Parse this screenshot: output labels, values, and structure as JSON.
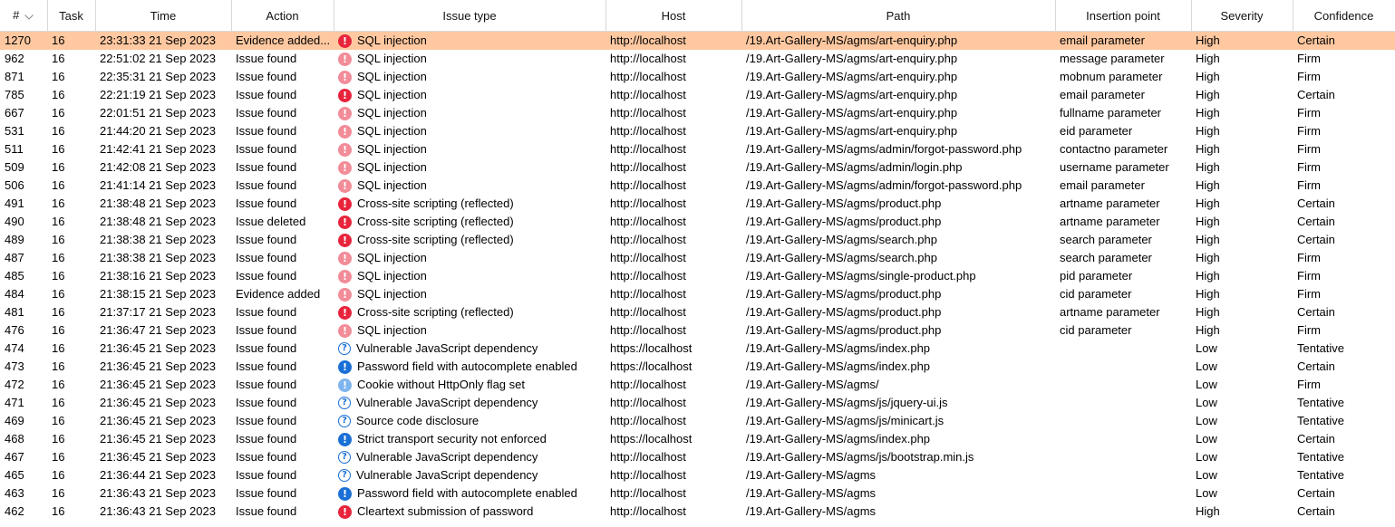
{
  "headers": {
    "num": "#",
    "task": "Task",
    "time": "Time",
    "action": "Action",
    "issue_type": "Issue type",
    "host": "Host",
    "path": "Path",
    "insertion_point": "Insertion point",
    "severity": "Severity",
    "confidence": "Confidence"
  },
  "colors": {
    "selected_row": "#ffc8a0",
    "high_certain": "#e8243c",
    "high_firm": "#f28c98",
    "info_certain": "#1a6fd6",
    "info_firm": "#7fb5ee"
  },
  "rows": [
    {
      "num": "1270",
      "task": "16",
      "time": "23:31:33 21 Sep 2023",
      "action": "Evidence added...",
      "icon": "high-certain",
      "issue": "SQL injection",
      "host": "http://localhost",
      "path": "/19.Art-Gallery-MS/agms/art-enquiry.php",
      "insertion": "email parameter",
      "severity": "High",
      "confidence": "Certain",
      "selected": true
    },
    {
      "num": "962",
      "task": "16",
      "time": "22:51:02 21 Sep 2023",
      "action": "Issue found",
      "icon": "high-firm",
      "issue": "SQL injection",
      "host": "http://localhost",
      "path": "/19.Art-Gallery-MS/agms/art-enquiry.php",
      "insertion": "message parameter",
      "severity": "High",
      "confidence": "Firm"
    },
    {
      "num": "871",
      "task": "16",
      "time": "22:35:31 21 Sep 2023",
      "action": "Issue found",
      "icon": "high-firm",
      "issue": "SQL injection",
      "host": "http://localhost",
      "path": "/19.Art-Gallery-MS/agms/art-enquiry.php",
      "insertion": "mobnum parameter",
      "severity": "High",
      "confidence": "Firm"
    },
    {
      "num": "785",
      "task": "16",
      "time": "22:21:19 21 Sep 2023",
      "action": "Issue found",
      "icon": "high-certain",
      "issue": "SQL injection",
      "host": "http://localhost",
      "path": "/19.Art-Gallery-MS/agms/art-enquiry.php",
      "insertion": "email parameter",
      "severity": "High",
      "confidence": "Certain"
    },
    {
      "num": "667",
      "task": "16",
      "time": "22:01:51 21 Sep 2023",
      "action": "Issue found",
      "icon": "high-firm",
      "issue": "SQL injection",
      "host": "http://localhost",
      "path": "/19.Art-Gallery-MS/agms/art-enquiry.php",
      "insertion": "fullname parameter",
      "severity": "High",
      "confidence": "Firm"
    },
    {
      "num": "531",
      "task": "16",
      "time": "21:44:20 21 Sep 2023",
      "action": "Issue found",
      "icon": "high-firm",
      "issue": "SQL injection",
      "host": "http://localhost",
      "path": "/19.Art-Gallery-MS/agms/art-enquiry.php",
      "insertion": "eid parameter",
      "severity": "High",
      "confidence": "Firm"
    },
    {
      "num": "511",
      "task": "16",
      "time": "21:42:41 21 Sep 2023",
      "action": "Issue found",
      "icon": "high-firm",
      "issue": "SQL injection",
      "host": "http://localhost",
      "path": "/19.Art-Gallery-MS/agms/admin/forgot-password.php",
      "insertion": "contactno parameter",
      "severity": "High",
      "confidence": "Firm"
    },
    {
      "num": "509",
      "task": "16",
      "time": "21:42:08 21 Sep 2023",
      "action": "Issue found",
      "icon": "high-firm",
      "issue": "SQL injection",
      "host": "http://localhost",
      "path": "/19.Art-Gallery-MS/agms/admin/login.php",
      "insertion": "username parameter",
      "severity": "High",
      "confidence": "Firm"
    },
    {
      "num": "506",
      "task": "16",
      "time": "21:41:14 21 Sep 2023",
      "action": "Issue found",
      "icon": "high-firm",
      "issue": "SQL injection",
      "host": "http://localhost",
      "path": "/19.Art-Gallery-MS/agms/admin/forgot-password.php",
      "insertion": "email parameter",
      "severity": "High",
      "confidence": "Firm"
    },
    {
      "num": "491",
      "task": "16",
      "time": "21:38:48 21 Sep 2023",
      "action": "Issue found",
      "icon": "high-certain",
      "issue": "Cross-site scripting (reflected)",
      "host": "http://localhost",
      "path": "/19.Art-Gallery-MS/agms/product.php",
      "insertion": "artname parameter",
      "severity": "High",
      "confidence": "Certain"
    },
    {
      "num": "490",
      "task": "16",
      "time": "21:38:48 21 Sep 2023",
      "action": "Issue deleted",
      "icon": "high-certain",
      "issue": "Cross-site scripting (reflected)",
      "host": "http://localhost",
      "path": "/19.Art-Gallery-MS/agms/product.php",
      "insertion": "artname parameter",
      "severity": "High",
      "confidence": "Certain"
    },
    {
      "num": "489",
      "task": "16",
      "time": "21:38:38 21 Sep 2023",
      "action": "Issue found",
      "icon": "high-certain",
      "issue": "Cross-site scripting (reflected)",
      "host": "http://localhost",
      "path": "/19.Art-Gallery-MS/agms/search.php",
      "insertion": "search parameter",
      "severity": "High",
      "confidence": "Certain"
    },
    {
      "num": "487",
      "task": "16",
      "time": "21:38:38 21 Sep 2023",
      "action": "Issue found",
      "icon": "high-firm",
      "issue": "SQL injection",
      "host": "http://localhost",
      "path": "/19.Art-Gallery-MS/agms/search.php",
      "insertion": "search parameter",
      "severity": "High",
      "confidence": "Firm"
    },
    {
      "num": "485",
      "task": "16",
      "time": "21:38:16 21 Sep 2023",
      "action": "Issue found",
      "icon": "high-firm",
      "issue": "SQL injection",
      "host": "http://localhost",
      "path": "/19.Art-Gallery-MS/agms/single-product.php",
      "insertion": "pid parameter",
      "severity": "High",
      "confidence": "Firm"
    },
    {
      "num": "484",
      "task": "16",
      "time": "21:38:15 21 Sep 2023",
      "action": "Evidence added",
      "icon": "high-firm",
      "issue": "SQL injection",
      "host": "http://localhost",
      "path": "/19.Art-Gallery-MS/agms/product.php",
      "insertion": "cid parameter",
      "severity": "High",
      "confidence": "Firm"
    },
    {
      "num": "481",
      "task": "16",
      "time": "21:37:17 21 Sep 2023",
      "action": "Issue found",
      "icon": "high-certain",
      "issue": "Cross-site scripting (reflected)",
      "host": "http://localhost",
      "path": "/19.Art-Gallery-MS/agms/product.php",
      "insertion": "artname parameter",
      "severity": "High",
      "confidence": "Certain"
    },
    {
      "num": "476",
      "task": "16",
      "time": "21:36:47 21 Sep 2023",
      "action": "Issue found",
      "icon": "high-firm",
      "issue": "SQL injection",
      "host": "http://localhost",
      "path": "/19.Art-Gallery-MS/agms/product.php",
      "insertion": "cid parameter",
      "severity": "High",
      "confidence": "Firm"
    },
    {
      "num": "474",
      "task": "16",
      "time": "21:36:45 21 Sep 2023",
      "action": "Issue found",
      "icon": "tentative",
      "issue": "Vulnerable JavaScript dependency",
      "host": "https://localhost",
      "path": "/19.Art-Gallery-MS/agms/index.php",
      "insertion": "",
      "severity": "Low",
      "confidence": "Tentative"
    },
    {
      "num": "473",
      "task": "16",
      "time": "21:36:45 21 Sep 2023",
      "action": "Issue found",
      "icon": "info-certain",
      "issue": "Password field with autocomplete enabled",
      "host": "https://localhost",
      "path": "/19.Art-Gallery-MS/agms/index.php",
      "insertion": "",
      "severity": "Low",
      "confidence": "Certain"
    },
    {
      "num": "472",
      "task": "16",
      "time": "21:36:45 21 Sep 2023",
      "action": "Issue found",
      "icon": "info-firm",
      "issue": "Cookie without HttpOnly flag set",
      "host": "http://localhost",
      "path": "/19.Art-Gallery-MS/agms/",
      "insertion": "",
      "severity": "Low",
      "confidence": "Firm"
    },
    {
      "num": "471",
      "task": "16",
      "time": "21:36:45 21 Sep 2023",
      "action": "Issue found",
      "icon": "tentative",
      "issue": "Vulnerable JavaScript dependency",
      "host": "http://localhost",
      "path": "/19.Art-Gallery-MS/agms/js/jquery-ui.js",
      "insertion": "",
      "severity": "Low",
      "confidence": "Tentative"
    },
    {
      "num": "469",
      "task": "16",
      "time": "21:36:45 21 Sep 2023",
      "action": "Issue found",
      "icon": "tentative",
      "issue": "Source code disclosure",
      "host": "http://localhost",
      "path": "/19.Art-Gallery-MS/agms/js/minicart.js",
      "insertion": "",
      "severity": "Low",
      "confidence": "Tentative"
    },
    {
      "num": "468",
      "task": "16",
      "time": "21:36:45 21 Sep 2023",
      "action": "Issue found",
      "icon": "info-certain",
      "issue": "Strict transport security not enforced",
      "host": "https://localhost",
      "path": "/19.Art-Gallery-MS/agms/index.php",
      "insertion": "",
      "severity": "Low",
      "confidence": "Certain"
    },
    {
      "num": "467",
      "task": "16",
      "time": "21:36:45 21 Sep 2023",
      "action": "Issue found",
      "icon": "tentative",
      "issue": "Vulnerable JavaScript dependency",
      "host": "http://localhost",
      "path": "/19.Art-Gallery-MS/agms/js/bootstrap.min.js",
      "insertion": "",
      "severity": "Low",
      "confidence": "Tentative"
    },
    {
      "num": "465",
      "task": "16",
      "time": "21:36:44 21 Sep 2023",
      "action": "Issue found",
      "icon": "tentative",
      "issue": "Vulnerable JavaScript dependency",
      "host": "http://localhost",
      "path": "/19.Art-Gallery-MS/agms",
      "insertion": "",
      "severity": "Low",
      "confidence": "Tentative"
    },
    {
      "num": "463",
      "task": "16",
      "time": "21:36:43 21 Sep 2023",
      "action": "Issue found",
      "icon": "info-certain",
      "issue": "Password field with autocomplete enabled",
      "host": "http://localhost",
      "path": "/19.Art-Gallery-MS/agms",
      "insertion": "",
      "severity": "Low",
      "confidence": "Certain"
    },
    {
      "num": "462",
      "task": "16",
      "time": "21:36:43 21 Sep 2023",
      "action": "Issue found",
      "icon": "high-certain",
      "issue": "Cleartext submission of password",
      "host": "http://localhost",
      "path": "/19.Art-Gallery-MS/agms",
      "insertion": "",
      "severity": "High",
      "confidence": "Certain"
    }
  ]
}
